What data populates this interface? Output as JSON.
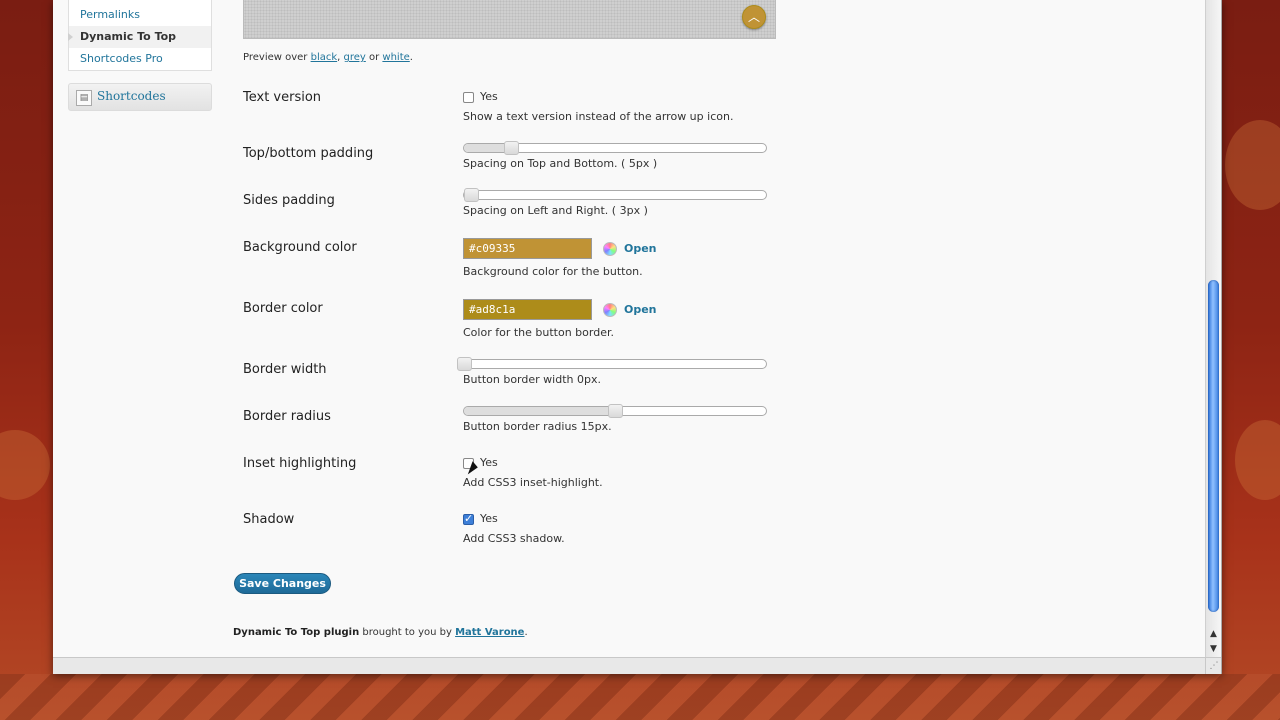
{
  "submenu": {
    "items": [
      {
        "label": "Permalinks"
      },
      {
        "label": "Dynamic To Top"
      },
      {
        "label": "Shortcodes Pro"
      }
    ]
  },
  "menu": {
    "shortcodes_label": "Shortcodes"
  },
  "preview": {
    "prefix": "Preview over ",
    "black": "black",
    "grey": "grey",
    "or": " or ",
    "white": "white",
    "comma": ", ",
    "period": ".",
    "button_color": "#c09335",
    "button_border": "#ad8c1a"
  },
  "settings": {
    "text_version": {
      "label": "Text version",
      "checkbox_label": "Yes",
      "checked": false,
      "desc": "Show a text version instead of the arrow up icon."
    },
    "top_bottom_padding": {
      "label": "Top/bottom padding",
      "desc": "Spacing on Top and Bottom. ( 5px )",
      "value": 5
    },
    "sides_padding": {
      "label": "Sides padding",
      "desc": "Spacing on Left and Right. ( 3px )",
      "value": 3
    },
    "background_color": {
      "label": "Background color",
      "value": "#c09335",
      "open": "Open",
      "desc": "Background color for the button."
    },
    "border_color": {
      "label": "Border color",
      "value": "#ad8c1a",
      "open": "Open",
      "desc": "Color for the button border."
    },
    "border_width": {
      "label": "Border width",
      "desc": "Button border width 0px.",
      "value": 0
    },
    "border_radius": {
      "label": "Border radius",
      "desc": "Button border radius 15px.",
      "value": 15
    },
    "inset_highlighting": {
      "label": "Inset highlighting",
      "checkbox_label": "Yes",
      "checked": false,
      "desc": "Add CSS3 inset-highlight."
    },
    "shadow": {
      "label": "Shadow",
      "checkbox_label": "Yes",
      "checked": true,
      "desc": "Add CSS3 shadow."
    }
  },
  "actions": {
    "save_label": "Save Changes"
  },
  "footer": {
    "plugin": "Dynamic To Top plugin",
    "text": " brought to you by ",
    "author": "Matt Varone",
    "period": "."
  },
  "colors": {
    "link": "#21759b",
    "accent_blue": "#3d7fd8",
    "scroll_thumb": "#4a90e2"
  }
}
